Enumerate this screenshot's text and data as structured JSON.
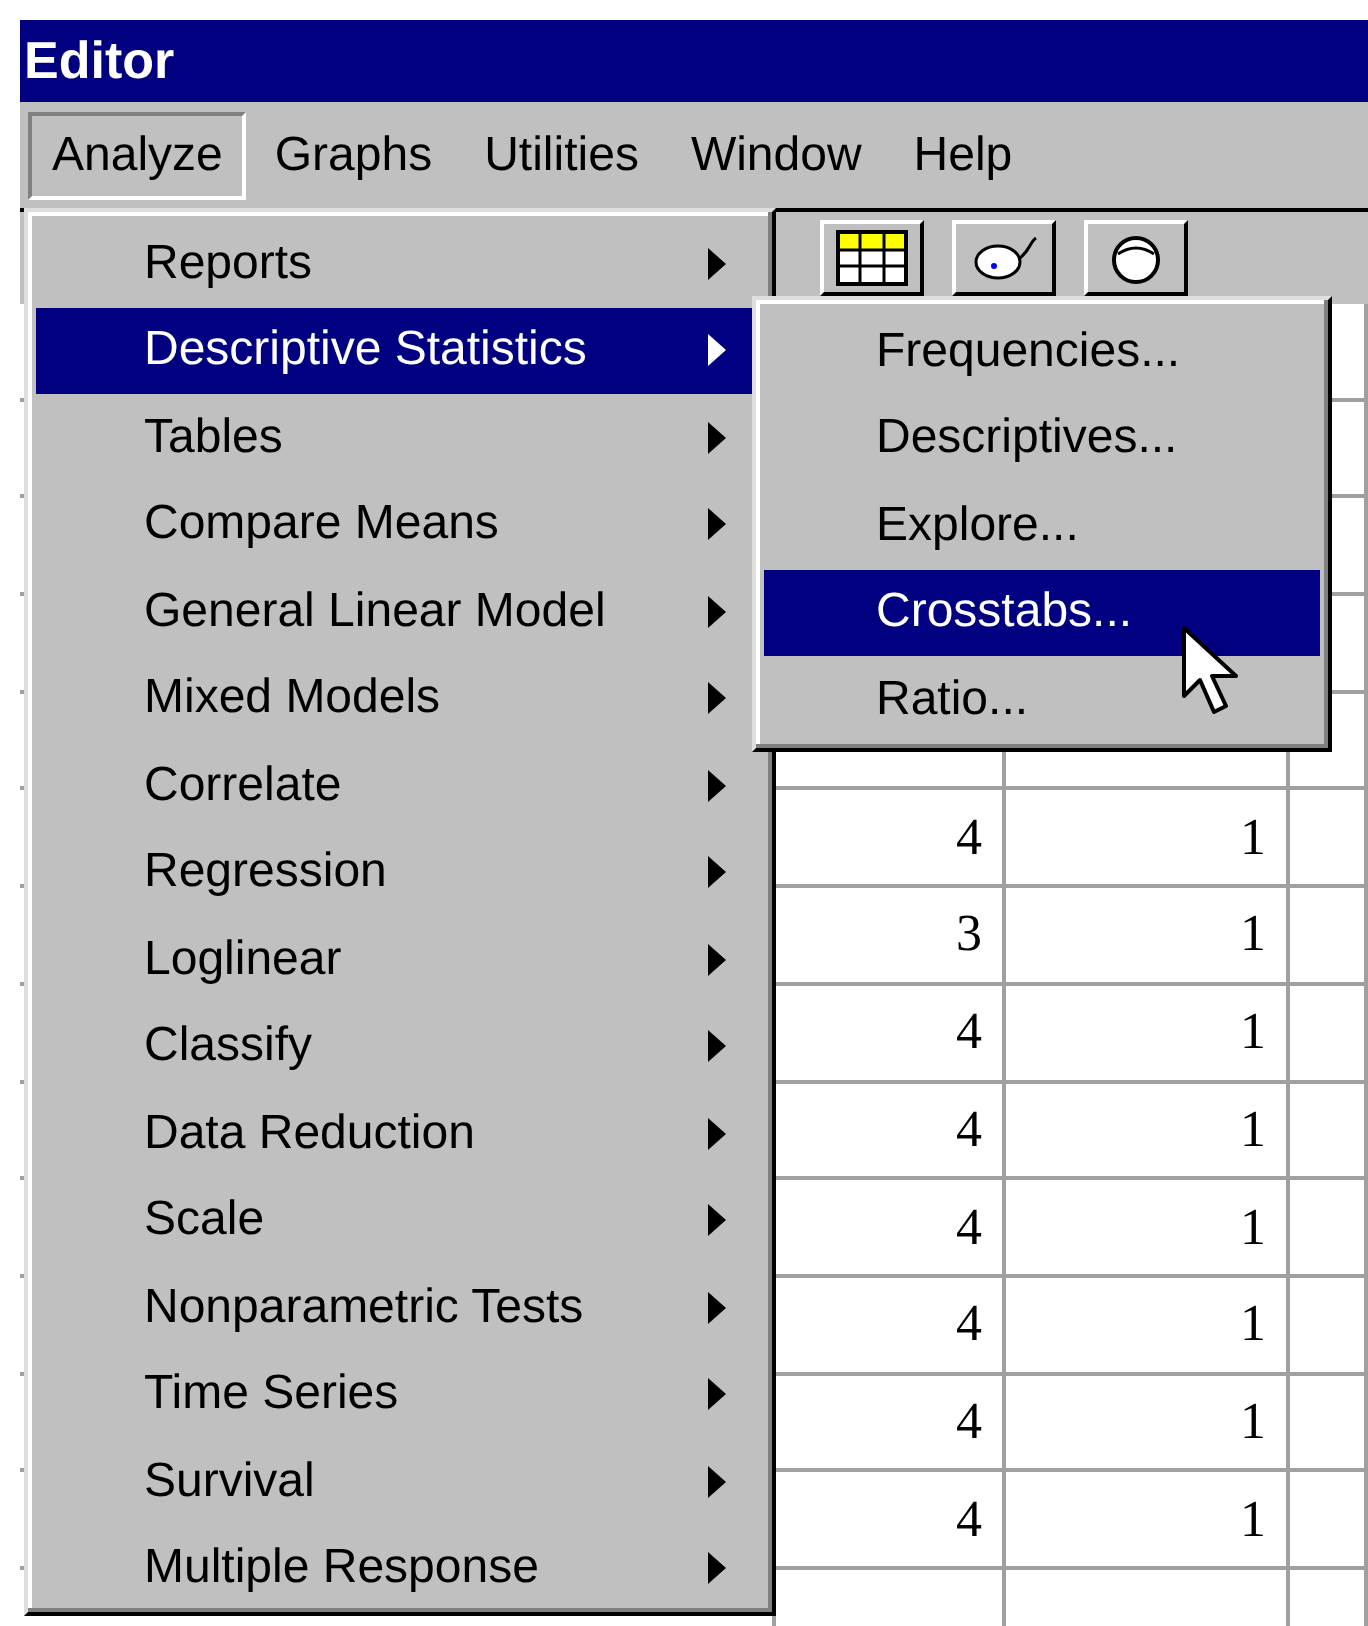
{
  "window": {
    "title": "Editor"
  },
  "menubar": [
    {
      "label": "Analyze",
      "selected": true
    },
    {
      "label": "Graphs",
      "selected": false
    },
    {
      "label": "Utilities",
      "selected": false
    },
    {
      "label": "Window",
      "selected": false
    },
    {
      "label": "Help",
      "selected": false
    }
  ],
  "menu": [
    {
      "label": "Reports",
      "selected": false
    },
    {
      "label": "Descriptive Statistics",
      "selected": true
    },
    {
      "label": "Tables",
      "selected": false
    },
    {
      "label": "Compare Means",
      "selected": false
    },
    {
      "label": "General Linear Model",
      "selected": false
    },
    {
      "label": "Mixed Models",
      "selected": false
    },
    {
      "label": "Correlate",
      "selected": false
    },
    {
      "label": "Regression",
      "selected": false
    },
    {
      "label": "Loglinear",
      "selected": false
    },
    {
      "label": "Classify",
      "selected": false
    },
    {
      "label": "Data Reduction",
      "selected": false
    },
    {
      "label": "Scale",
      "selected": false
    },
    {
      "label": "Nonparametric Tests",
      "selected": false
    },
    {
      "label": "Time Series",
      "selected": false
    },
    {
      "label": "Survival",
      "selected": false
    },
    {
      "label": "Multiple Response",
      "selected": false
    }
  ],
  "submenu": [
    {
      "label": "Frequencies...",
      "selected": false
    },
    {
      "label": "Descriptives...",
      "selected": false
    },
    {
      "label": "Explore...",
      "selected": false
    },
    {
      "label": "Crosstabs...",
      "selected": true
    },
    {
      "label": "Ratio...",
      "selected": false
    }
  ],
  "grid_rows": [
    [
      "4",
      "1"
    ],
    [
      "3",
      "1"
    ],
    [
      "4",
      "1"
    ],
    [
      "4",
      "1"
    ],
    [
      "4",
      "1"
    ],
    [
      "4",
      "1"
    ],
    [
      "4",
      "1"
    ],
    [
      "4",
      "1"
    ]
  ]
}
